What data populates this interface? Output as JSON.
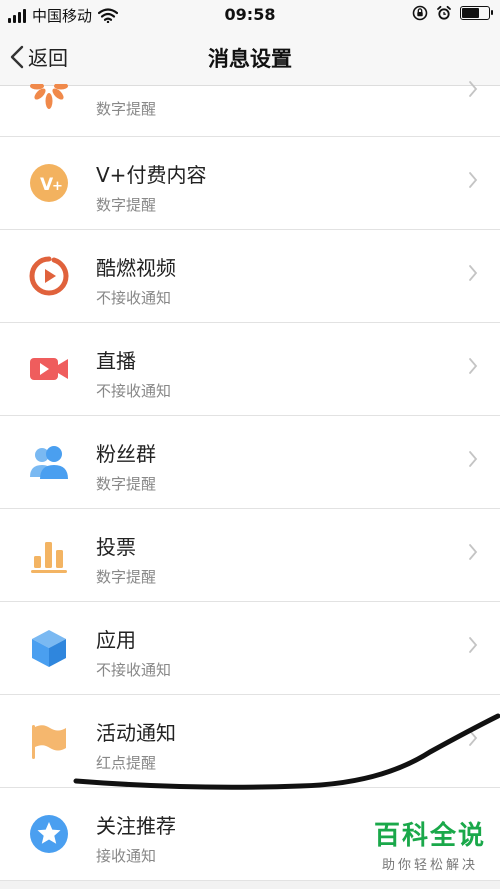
{
  "status_bar": {
    "carrier": "中国移动",
    "time": "09:58",
    "battery_level": 0.62
  },
  "nav": {
    "back_label": "返回",
    "title": "消息设置"
  },
  "items": [
    {
      "title": "",
      "subtitle": "数字提醒",
      "icon": "orange-flower-icon"
    },
    {
      "title": "V+付费内容",
      "subtitle": "数字提醒",
      "icon": "vplus-icon"
    },
    {
      "title": "酷燃视频",
      "subtitle": "不接收通知",
      "icon": "video-play-icon"
    },
    {
      "title": "直播",
      "subtitle": "不接收通知",
      "icon": "camera-icon"
    },
    {
      "title": "粉丝群",
      "subtitle": "数字提醒",
      "icon": "group-icon"
    },
    {
      "title": "投票",
      "subtitle": "数字提醒",
      "icon": "bar-chart-icon"
    },
    {
      "title": "应用",
      "subtitle": "不接收通知",
      "icon": "cube-icon"
    },
    {
      "title": "活动通知",
      "subtitle": "红点提醒",
      "icon": "flag-icon"
    },
    {
      "title": "关注推荐",
      "subtitle": "接收通知",
      "icon": "star-badge-icon"
    }
  ],
  "watermark": {
    "main": "百科全说",
    "sub": "助你轻松解决"
  },
  "colors": {
    "orange": "#f0894a",
    "vplus": "#f3b25f",
    "video": "#e0623c",
    "live": "#ef5d5d",
    "blue": "#4a9ff0",
    "vote": "#f3b463",
    "flag": "#f5b76e",
    "watermark_green": "#1aa84a"
  }
}
